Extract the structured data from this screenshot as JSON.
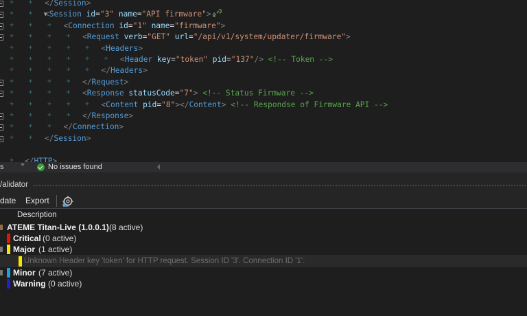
{
  "editor": {
    "lines": [
      {
        "level": 2,
        "parts": [
          [
            "br",
            "</"
          ],
          [
            "tag",
            "Session"
          ],
          [
            "br",
            ">"
          ]
        ]
      },
      {
        "level": 2,
        "collapsible": true,
        "hint": true,
        "parts": [
          [
            "br",
            "<"
          ],
          [
            "tag",
            "Session"
          ],
          [
            "eq",
            " "
          ],
          [
            "attr",
            "id"
          ],
          [
            "eq",
            "="
          ],
          [
            "val",
            "\"3\""
          ],
          [
            "eq",
            " "
          ],
          [
            "attr",
            "name"
          ],
          [
            "eq",
            "="
          ],
          [
            "val",
            "\"API firmware\""
          ],
          [
            "br",
            ">"
          ]
        ]
      },
      {
        "level": 3,
        "parts": [
          [
            "br",
            "<"
          ],
          [
            "tag",
            "Connection"
          ],
          [
            "eq",
            " "
          ],
          [
            "attr",
            "id"
          ],
          [
            "eq",
            "="
          ],
          [
            "val",
            "\"1\""
          ],
          [
            "eq",
            " "
          ],
          [
            "attr",
            "name"
          ],
          [
            "eq",
            "="
          ],
          [
            "val",
            "\"firmware\""
          ],
          [
            "br",
            ">"
          ]
        ]
      },
      {
        "level": 4,
        "parts": [
          [
            "br",
            "<"
          ],
          [
            "tag",
            "Request"
          ],
          [
            "eq",
            " "
          ],
          [
            "attr",
            "verb"
          ],
          [
            "eq",
            "="
          ],
          [
            "val",
            "\"GET\""
          ],
          [
            "eq",
            " "
          ],
          [
            "attr",
            "url"
          ],
          [
            "eq",
            "="
          ],
          [
            "val",
            "\"/api/v1/system/updater/firmware\""
          ],
          [
            "br",
            ">"
          ]
        ]
      },
      {
        "level": 5,
        "parts": [
          [
            "br",
            "<"
          ],
          [
            "tag",
            "Headers"
          ],
          [
            "br",
            ">"
          ]
        ]
      },
      {
        "level": 6,
        "parts": [
          [
            "br",
            "<"
          ],
          [
            "tag",
            "Header"
          ],
          [
            "eq",
            " "
          ],
          [
            "attr",
            "key"
          ],
          [
            "eq",
            "="
          ],
          [
            "val",
            "\"token\""
          ],
          [
            "eq",
            " "
          ],
          [
            "attr",
            "pid"
          ],
          [
            "eq",
            "="
          ],
          [
            "val",
            "\"137\""
          ],
          [
            "br",
            "/>"
          ],
          [
            "eq",
            " "
          ],
          [
            "com",
            "<!-- Token -->"
          ]
        ]
      },
      {
        "level": 5,
        "parts": [
          [
            "br",
            "</"
          ],
          [
            "tag",
            "Headers"
          ],
          [
            "br",
            ">"
          ]
        ]
      },
      {
        "level": 4,
        "parts": [
          [
            "br",
            "</"
          ],
          [
            "tag",
            "Request"
          ],
          [
            "br",
            ">"
          ]
        ]
      },
      {
        "level": 4,
        "parts": [
          [
            "br",
            "<"
          ],
          [
            "tag",
            "Response"
          ],
          [
            "eq",
            " "
          ],
          [
            "attr",
            "statusCode"
          ],
          [
            "eq",
            "="
          ],
          [
            "val",
            "\"7\""
          ],
          [
            "br",
            ">"
          ],
          [
            "eq",
            " "
          ],
          [
            "com",
            "<!-- Status Firmware -->"
          ]
        ]
      },
      {
        "level": 5,
        "parts": [
          [
            "br",
            "<"
          ],
          [
            "tag",
            "Content"
          ],
          [
            "eq",
            " "
          ],
          [
            "attr",
            "pid"
          ],
          [
            "eq",
            "="
          ],
          [
            "val",
            "\"8\""
          ],
          [
            "br",
            "></"
          ],
          [
            "tag",
            "Content"
          ],
          [
            "br",
            ">"
          ],
          [
            "eq",
            " "
          ],
          [
            "com",
            "<!-- Respondse of Firmware API -->"
          ]
        ]
      },
      {
        "level": 4,
        "parts": [
          [
            "br",
            "</"
          ],
          [
            "tag",
            "Response"
          ],
          [
            "br",
            ">"
          ]
        ]
      },
      {
        "level": 3,
        "parts": [
          [
            "br",
            "</"
          ],
          [
            "tag",
            "Connection"
          ],
          [
            "br",
            ">"
          ]
        ]
      },
      {
        "level": 2,
        "parts": [
          [
            "br",
            "</"
          ],
          [
            "tag",
            "Session"
          ],
          [
            "br",
            ">"
          ]
        ]
      },
      {
        "level": 0,
        "parts": []
      },
      {
        "level": 1,
        "parts": [
          [
            "br",
            "</"
          ],
          [
            "tag",
            "HTTP"
          ],
          [
            "br",
            ">"
          ]
        ]
      }
    ]
  },
  "status": {
    "left_char": "s",
    "message": "No issues found"
  },
  "panel": {
    "title": "/alidator",
    "toolbar": {
      "update_label": "date",
      "export_label": "Export"
    },
    "header": {
      "description": "Description"
    },
    "root": {
      "name": "ATEME Titan-Live (1.0.0.1)",
      "count": "(8 active)"
    },
    "categories": [
      {
        "name": "Critical",
        "count": "(0 active)",
        "color": "#e51400"
      },
      {
        "name": "Major",
        "count": "(1 active)",
        "color": "#f5e500"
      },
      {
        "name": "Minor",
        "count": "(7 active)",
        "color": "#1ba1e2"
      },
      {
        "name": "Warning",
        "count": "(0 active)",
        "color": "#1f1fd8"
      }
    ],
    "major_issue": "Unknown Header key 'token' for HTTP request. Session ID '3'. Connection ID '1'."
  }
}
